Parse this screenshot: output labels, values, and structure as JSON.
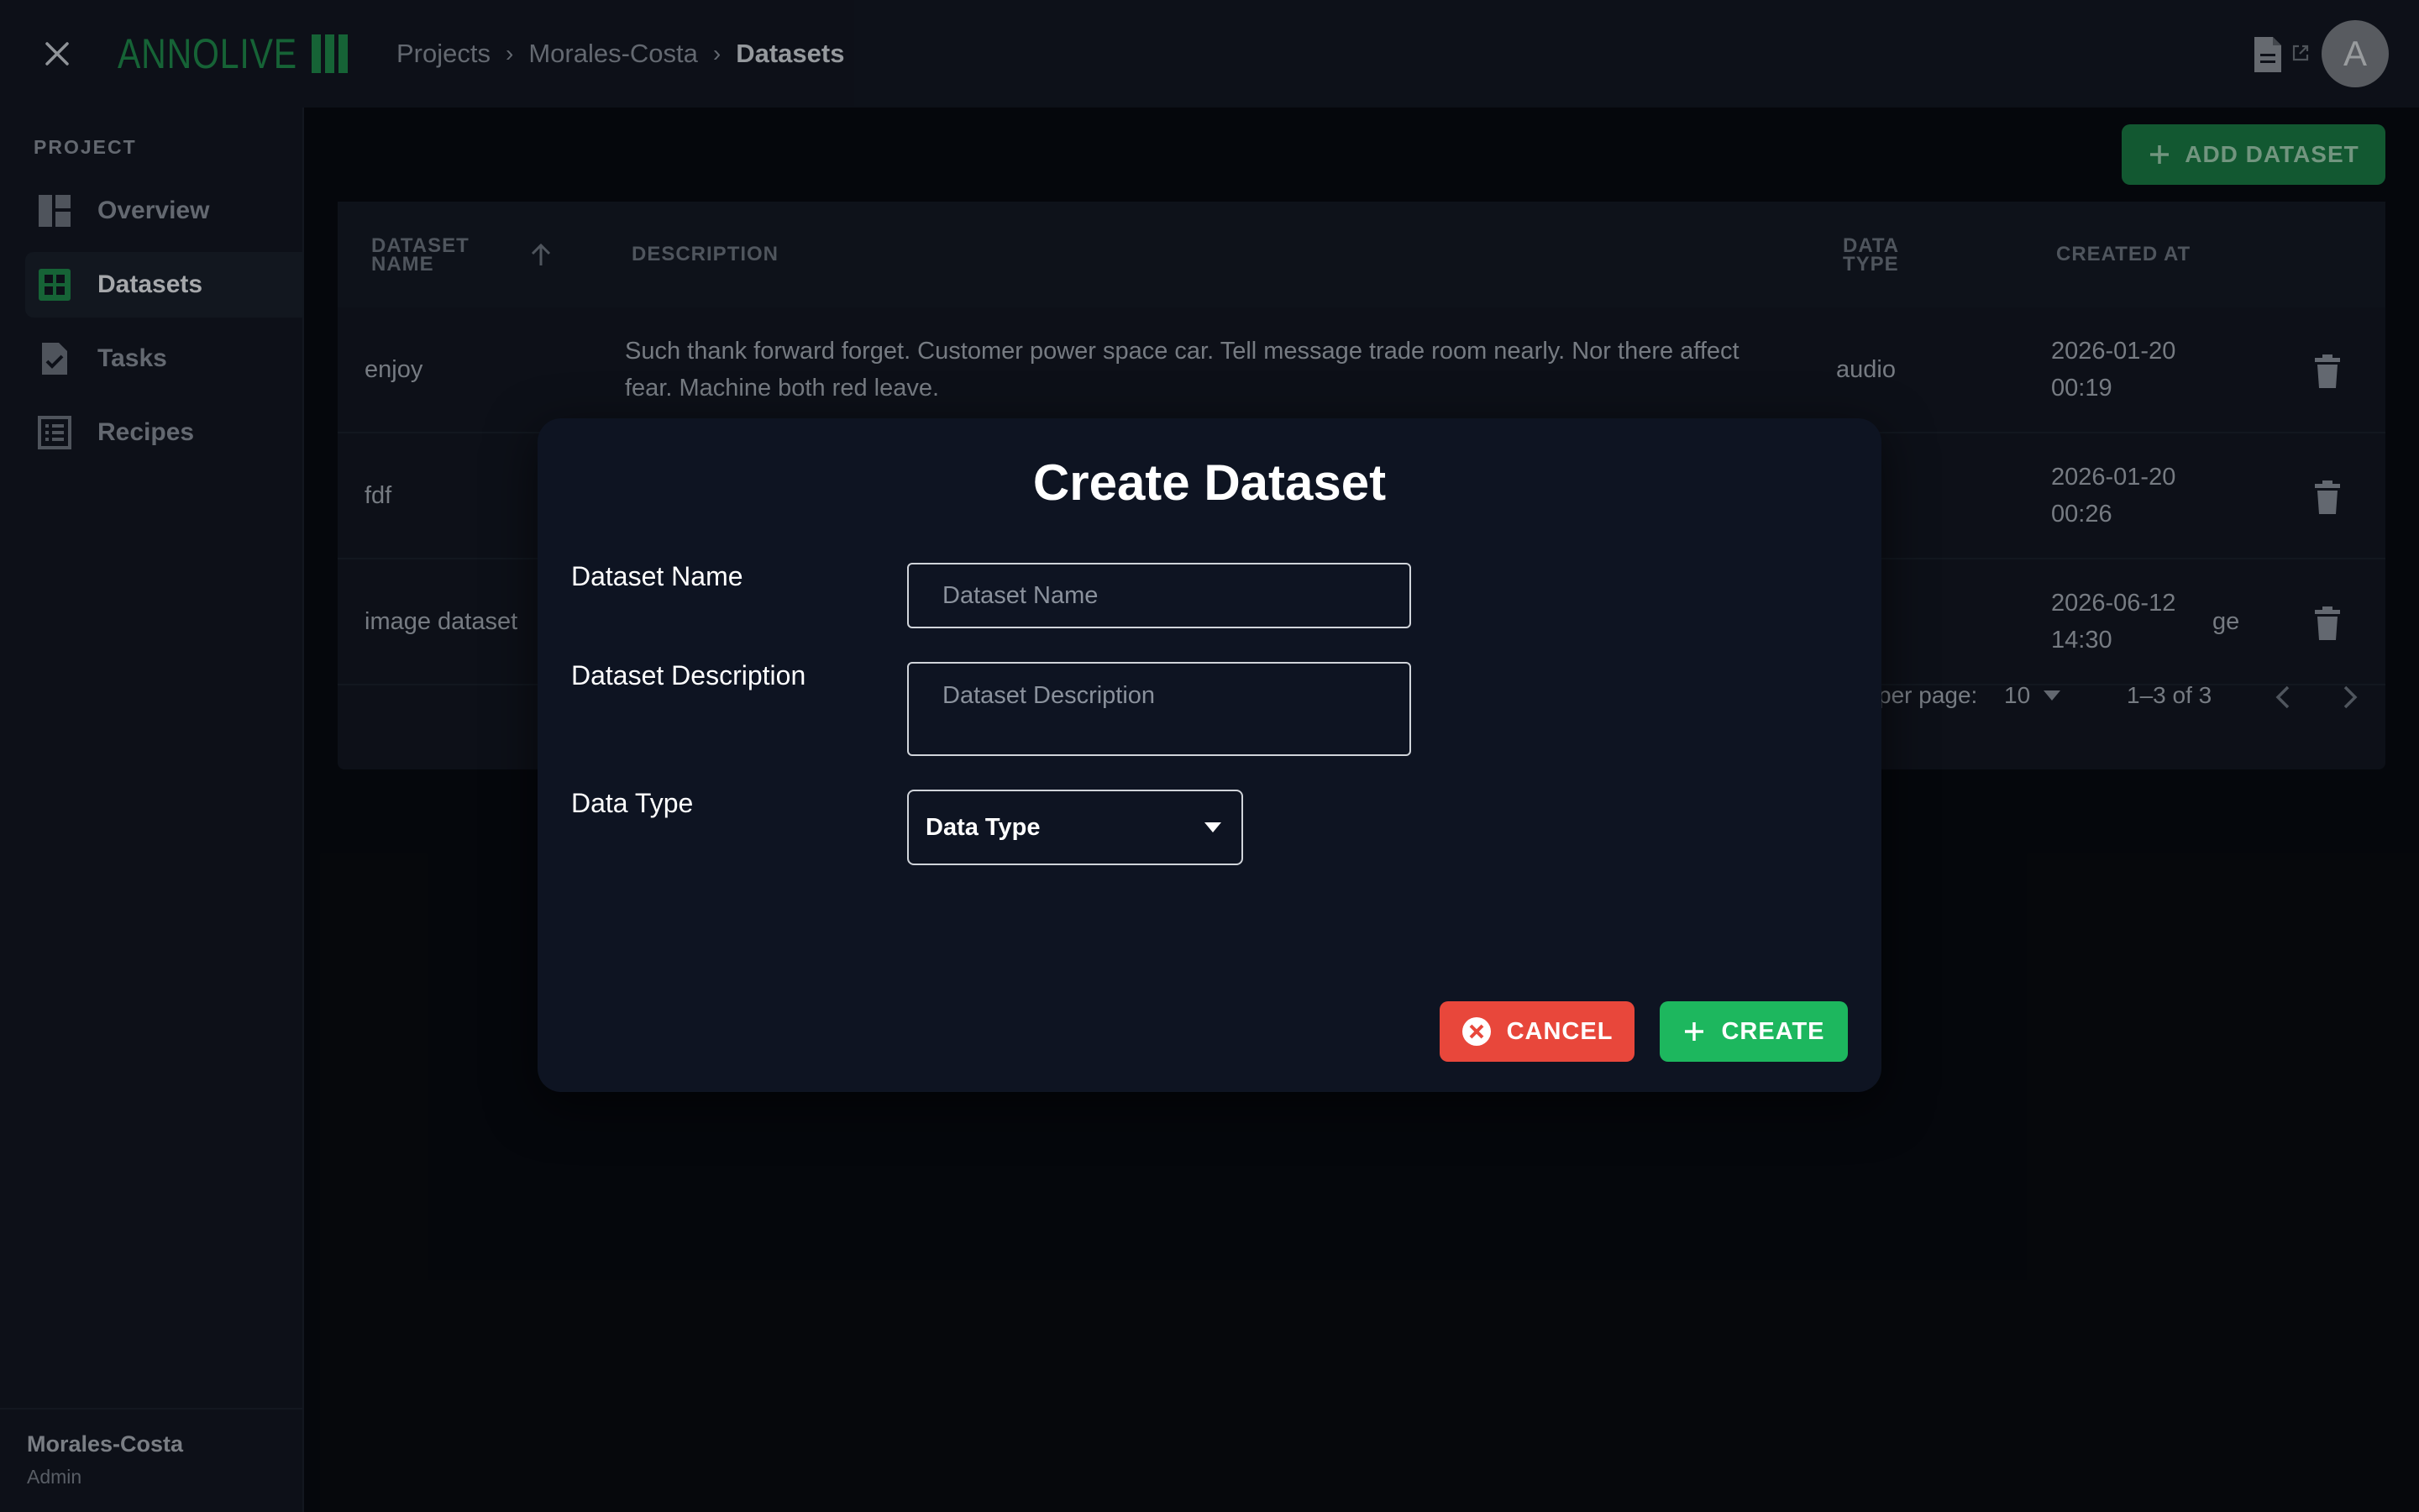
{
  "header": {
    "logo_text": "ANNOLIVE",
    "breadcrumb": [
      "Projects",
      "Morales-Costa",
      "Datasets"
    ],
    "avatar_initial": "A"
  },
  "sidebar": {
    "section_label": "PROJECT",
    "items": [
      {
        "label": "Overview",
        "icon": "dashboard-icon",
        "active": false
      },
      {
        "label": "Datasets",
        "icon": "grid-table-icon",
        "active": true
      },
      {
        "label": "Tasks",
        "icon": "task-check-icon",
        "active": false
      },
      {
        "label": "Recipes",
        "icon": "list-icon",
        "active": false
      }
    ],
    "footer": {
      "name": "Morales-Costa",
      "role": "Admin"
    }
  },
  "toolbar": {
    "add_dataset_label": "ADD DATASET"
  },
  "table": {
    "columns": [
      "DATASET NAME",
      "DESCRIPTION",
      "DATA TYPE",
      "CREATED AT"
    ],
    "rows": [
      {
        "name": "enjoy",
        "description": "Such thank forward forget. Customer power space car. Tell message trade room nearly. Nor there affect fear. Machine both red leave.",
        "data_type": "audio",
        "created_date": "2026-01-20",
        "created_time": "00:19"
      },
      {
        "name": "fdf",
        "description": "",
        "data_type": "",
        "created_date": "2026-01-20",
        "created_time": "00:26"
      },
      {
        "name": "image dataset",
        "description": "",
        "data_type": "ge",
        "created_date": "2026-06-12",
        "created_time": "14:30"
      }
    ],
    "pagination": {
      "rows_per_page_label": "per page:",
      "rows_per_page": "10",
      "range": "1–3 of 3"
    }
  },
  "modal": {
    "title": "Create Dataset",
    "name_label": "Dataset Name",
    "name_placeholder": "Dataset Name",
    "description_label": "Dataset Description",
    "description_placeholder": "Dataset Description",
    "type_label": "Data Type",
    "type_value": "Data Type",
    "cancel_label": "CANCEL",
    "create_label": "CREATE"
  },
  "colors": {
    "brand_green": "#1f8a4c",
    "cancel_red": "#e8473b",
    "create_green": "#1db75e"
  }
}
